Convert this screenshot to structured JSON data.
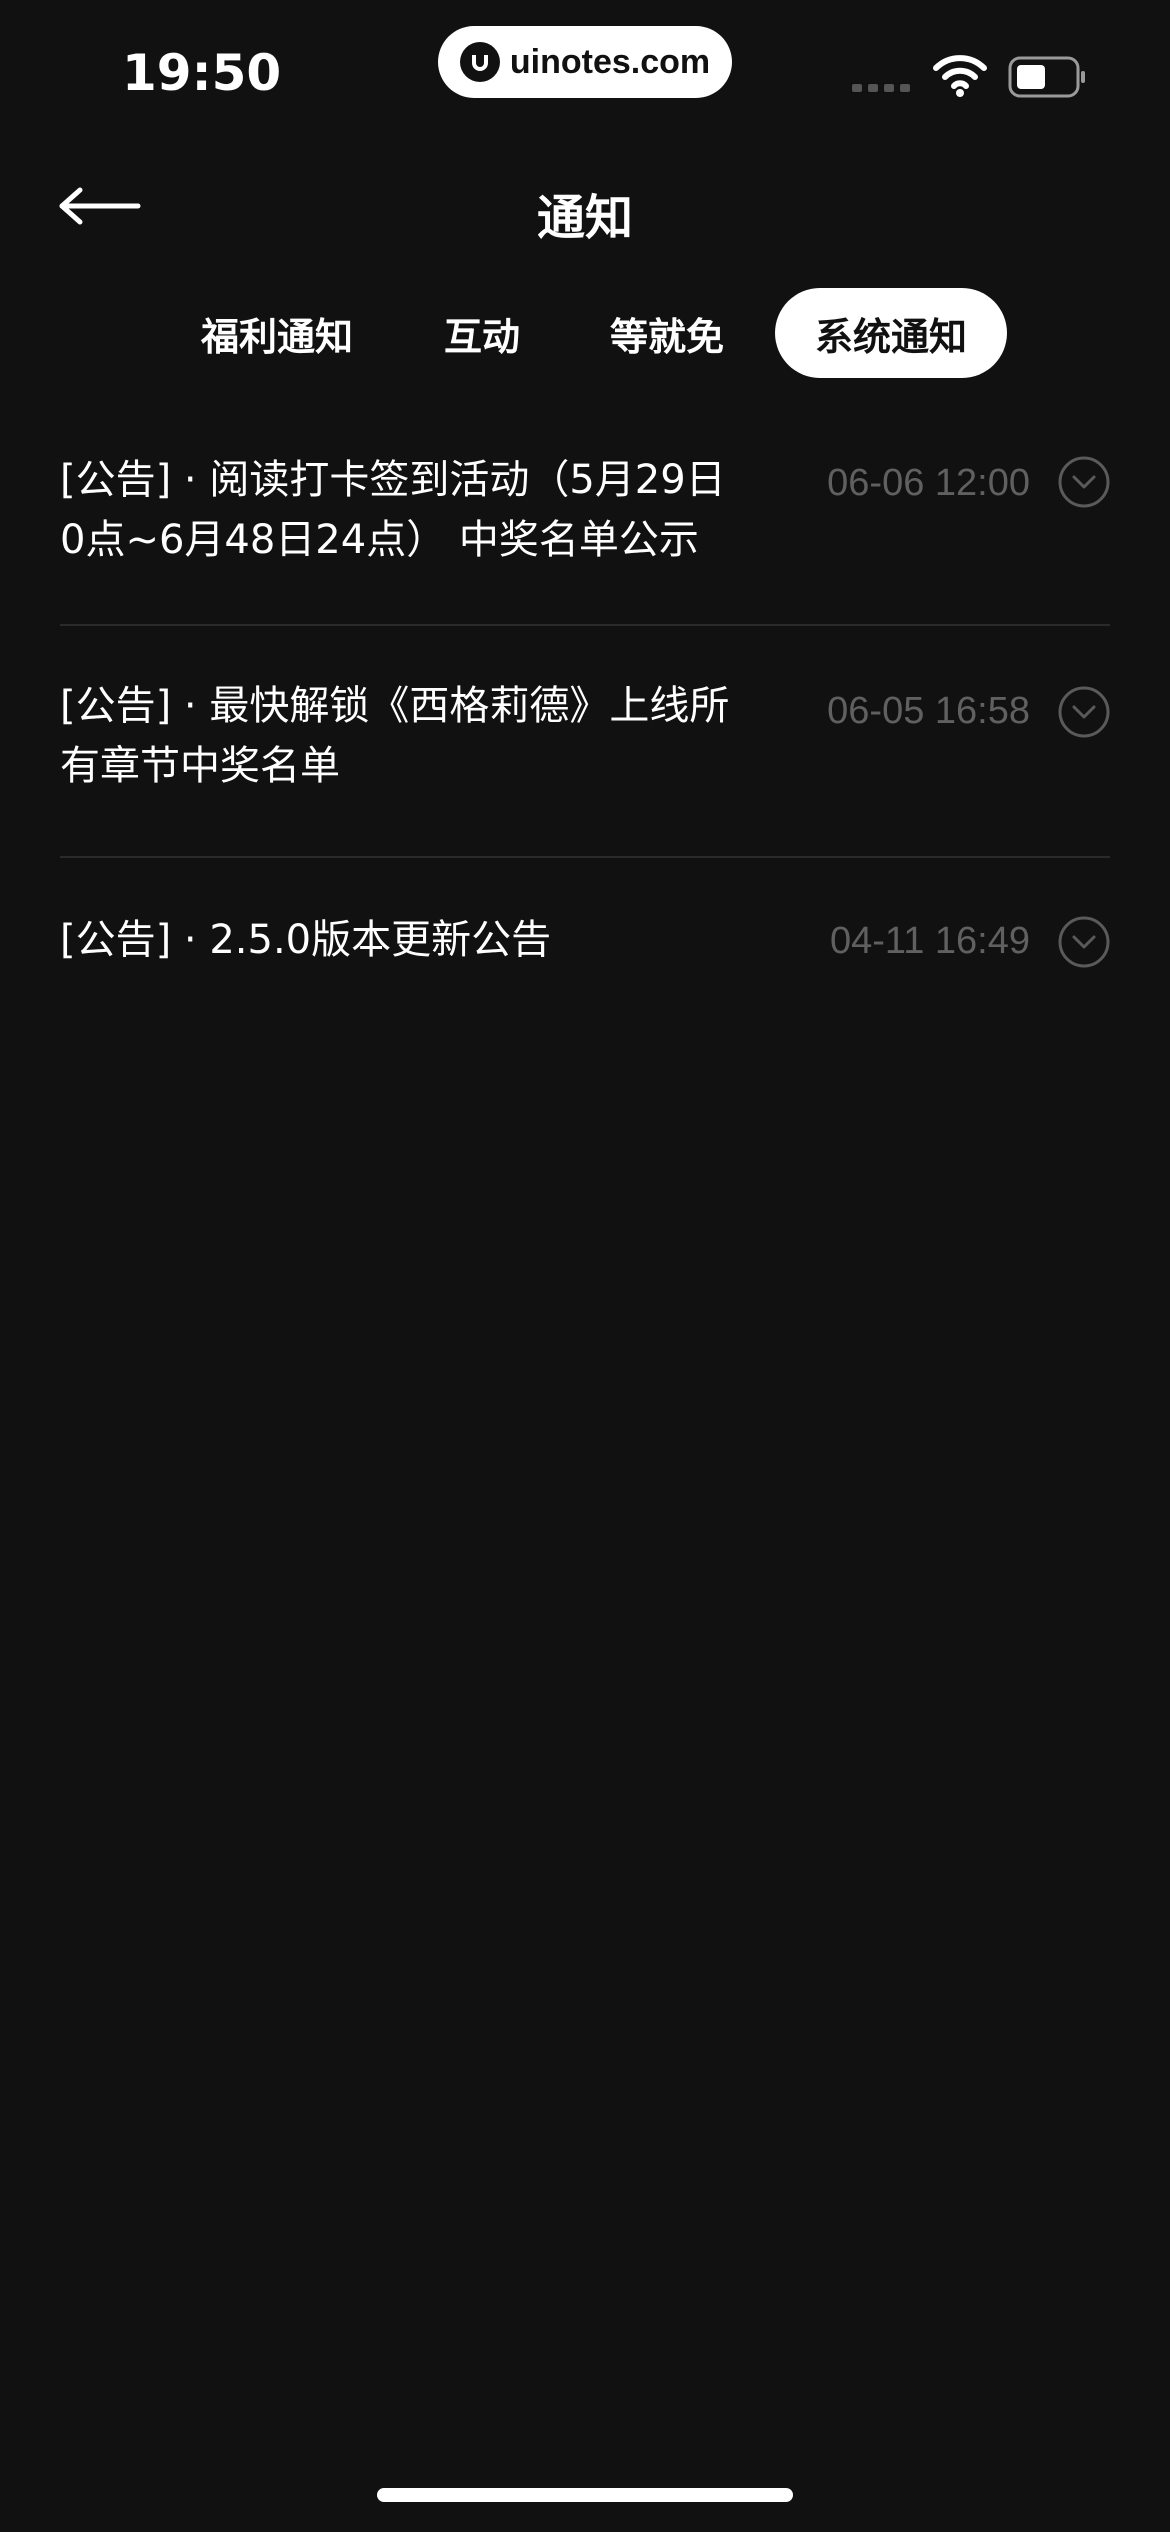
{
  "status_bar": {
    "time": "19:50",
    "watermark": "uinotes.com",
    "icons": [
      "signal-icon",
      "wifi-icon",
      "battery-icon"
    ]
  },
  "header": {
    "title": "通知",
    "back_icon": "back-arrow-icon"
  },
  "tabs": [
    {
      "label": "福利通知",
      "active": false
    },
    {
      "label": "互动",
      "active": false
    },
    {
      "label": "等就免",
      "active": false
    },
    {
      "label": "系统通知",
      "active": true
    }
  ],
  "notifications": [
    {
      "title": "[公告] · 阅读打卡签到活动（5月29日\n0点~6月48日24点） 中奖名单公示",
      "time": "06-06 12:00",
      "icon": "chevron-down-circle-icon"
    },
    {
      "title": "[公告] · 最快解锁《西格莉德》上线所\n有章节中奖名单",
      "time": "06-05 16:58",
      "icon": "chevron-down-circle-icon"
    },
    {
      "title": "[公告] · 2.5.0版本更新公告",
      "time": "04-11 16:49",
      "icon": "chevron-down-circle-icon"
    }
  ],
  "colors": {
    "background": "#111111",
    "text": "#ffffff",
    "muted_text": "#606060",
    "divider": "#2a2a2a",
    "active_tab_bg": "#ffffff",
    "active_tab_text": "#111111"
  }
}
